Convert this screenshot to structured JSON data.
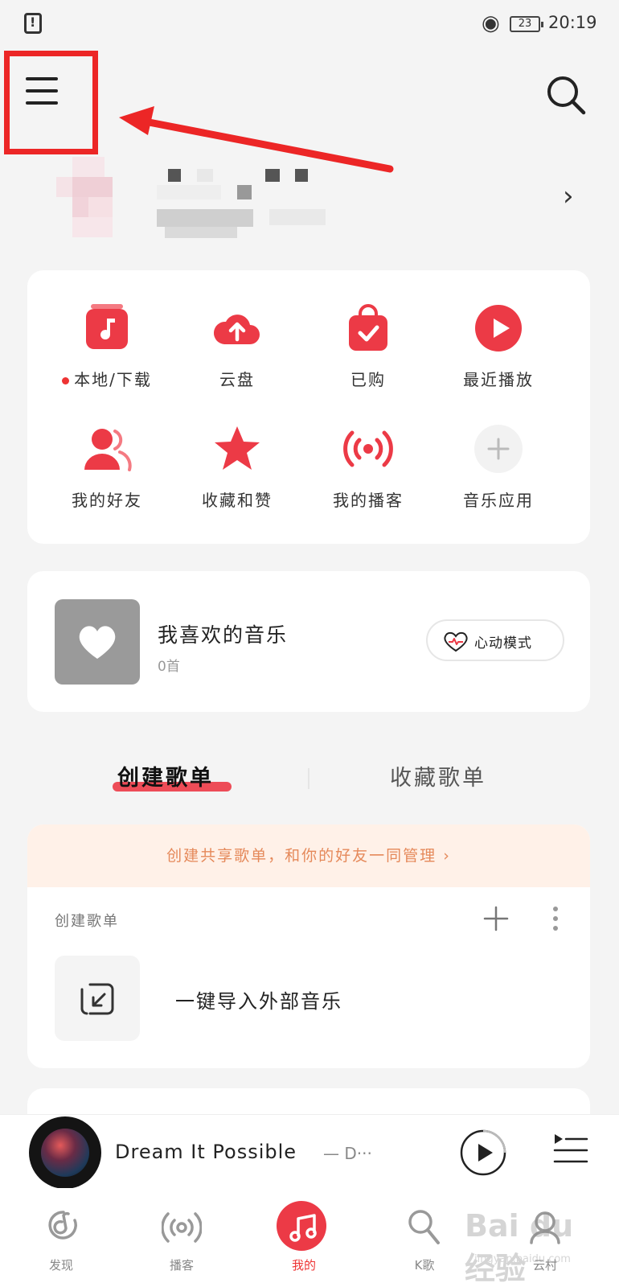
{
  "status_bar": {
    "battery": "23",
    "time": "20:19"
  },
  "quick_actions": [
    {
      "label": "本地/下载",
      "icon": "local-download-icon"
    },
    {
      "label": "云盘",
      "icon": "cloud-upload-icon"
    },
    {
      "label": "已购",
      "icon": "purchased-bag-icon"
    },
    {
      "label": "最近播放",
      "icon": "recent-play-icon"
    },
    {
      "label": "我的好友",
      "icon": "friends-icon"
    },
    {
      "label": "收藏和赞",
      "icon": "star-icon"
    },
    {
      "label": "我的播客",
      "icon": "podcast-icon"
    },
    {
      "label": "音乐应用",
      "icon": "add-app-icon"
    }
  ],
  "favorites": {
    "title": "我喜欢的音乐",
    "count": "0首",
    "heart_mode_label": "心动模式"
  },
  "tabs": {
    "created": "创建歌单",
    "collected": "收藏歌单"
  },
  "playlists": {
    "share_banner": "创建共享歌单，和你的好友一同管理",
    "section_label": "创建歌单",
    "import_label": "一键导入外部音乐"
  },
  "player": {
    "song_title": "Dream It Possible",
    "artist_snippet": "— D···"
  },
  "bottom_nav": [
    {
      "label": "发现",
      "icon": "discover-icon"
    },
    {
      "label": "播客",
      "icon": "podcast-nav-icon"
    },
    {
      "label": "我的",
      "icon": "music-note-icon"
    },
    {
      "label": "K歌",
      "icon": "karaoke-mic-icon"
    },
    {
      "label": "云村",
      "icon": "community-icon"
    }
  ],
  "watermark": {
    "text": "Bai du 经验",
    "sub": "jingyan.baidu.com"
  },
  "colors": {
    "accent": "#ec3a46",
    "highlight_box": "#ec2626",
    "share_banner_bg": "#fff1e8",
    "share_banner_text": "#e5895a"
  }
}
